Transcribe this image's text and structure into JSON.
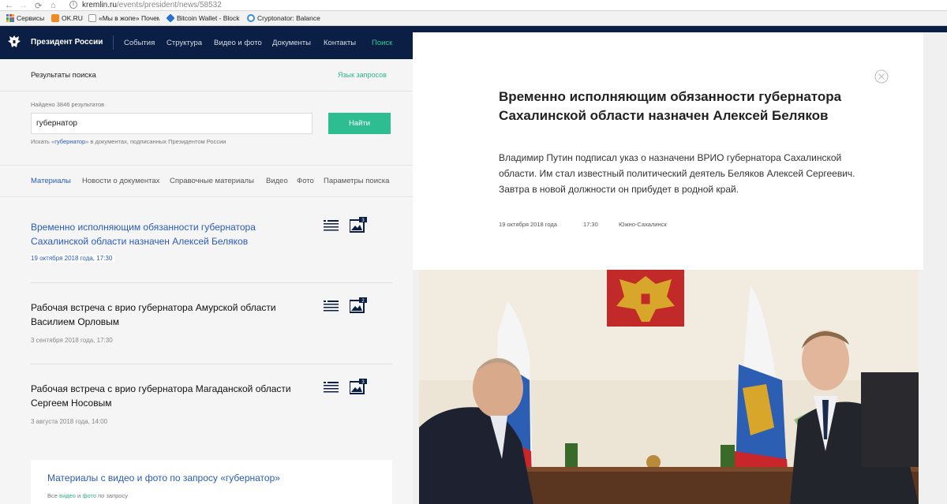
{
  "browser": {
    "url_host": "kremlin.ru",
    "url_path": "/events/president/news/58532",
    "bookmarks": [
      {
        "label": "Сервисы",
        "color": "#4a7ad8"
      },
      {
        "label": "OK.RU",
        "color": "#f08a24"
      },
      {
        "label": "«Мы в жопе» Почем",
        "color": "#bbbbbb"
      },
      {
        "label": "Bitcoin Wallet - Block",
        "color": "#2b6fd1"
      },
      {
        "label": "Cryptonator: Balance",
        "color": "#3a8fd1"
      }
    ]
  },
  "header": {
    "title": "Президент России",
    "nav": [
      "События",
      "Структура",
      "Видео и фото",
      "Документы",
      "Контакты",
      "Поиск"
    ]
  },
  "search": {
    "heading": "Результаты поиска",
    "query_lang": "Язык запросов",
    "found": "Найдено 3846 результатов",
    "value": "губернатор",
    "button": "Найти",
    "hint_prefix": "Искать «",
    "hint_query": "губернатор",
    "hint_suffix": "» в документах, подписанных Президентом России",
    "tabs": [
      "Материалы",
      "Новости о документах",
      "Справочные материалы",
      "Видео",
      "Фото",
      "Параметры поиска"
    ]
  },
  "results": [
    {
      "title": "Временно исполняющим обязанности губернатора Сахалинской области назначен Алексей Беляков",
      "date": "19 октября 2018 года, 17:30",
      "photos": "3"
    },
    {
      "title": "Рабочая встреча с врио губернатора Амурской области Василием Орловым",
      "date": "3 сентября 2018 года, 17:30",
      "photos": "2"
    },
    {
      "title": "Рабочая встреча с врио губернатора Магаданской области Сергеем Носовым",
      "date": "3 августа 2018 года, 14:00",
      "photos": "3"
    }
  ],
  "media": {
    "title": "Материалы с видео и фото по запросу «губернатор»",
    "all": "Все",
    "video": "видео",
    "and": "и",
    "photo": "фото",
    "suffix": "по запросу"
  },
  "article": {
    "title": "Временно исполняющим обязанности губернатора Сахалинской области назначен Алексей Беляков",
    "lead": "Владимир Путин подписал указ о назначени ВРИО губернатора Сахалинской области. Им стал известный политический деятель Беляков Алексей Сергеевич. Завтра в новой должности он прибудет в родной край.",
    "date": "19 октября 2018 года",
    "time": "17:30",
    "place": "Южно-Сахалинск"
  },
  "colors": {
    "header_bg": "#0b1f44",
    "accent_green": "#2ebd91",
    "link_blue": "#2a5bb8"
  }
}
